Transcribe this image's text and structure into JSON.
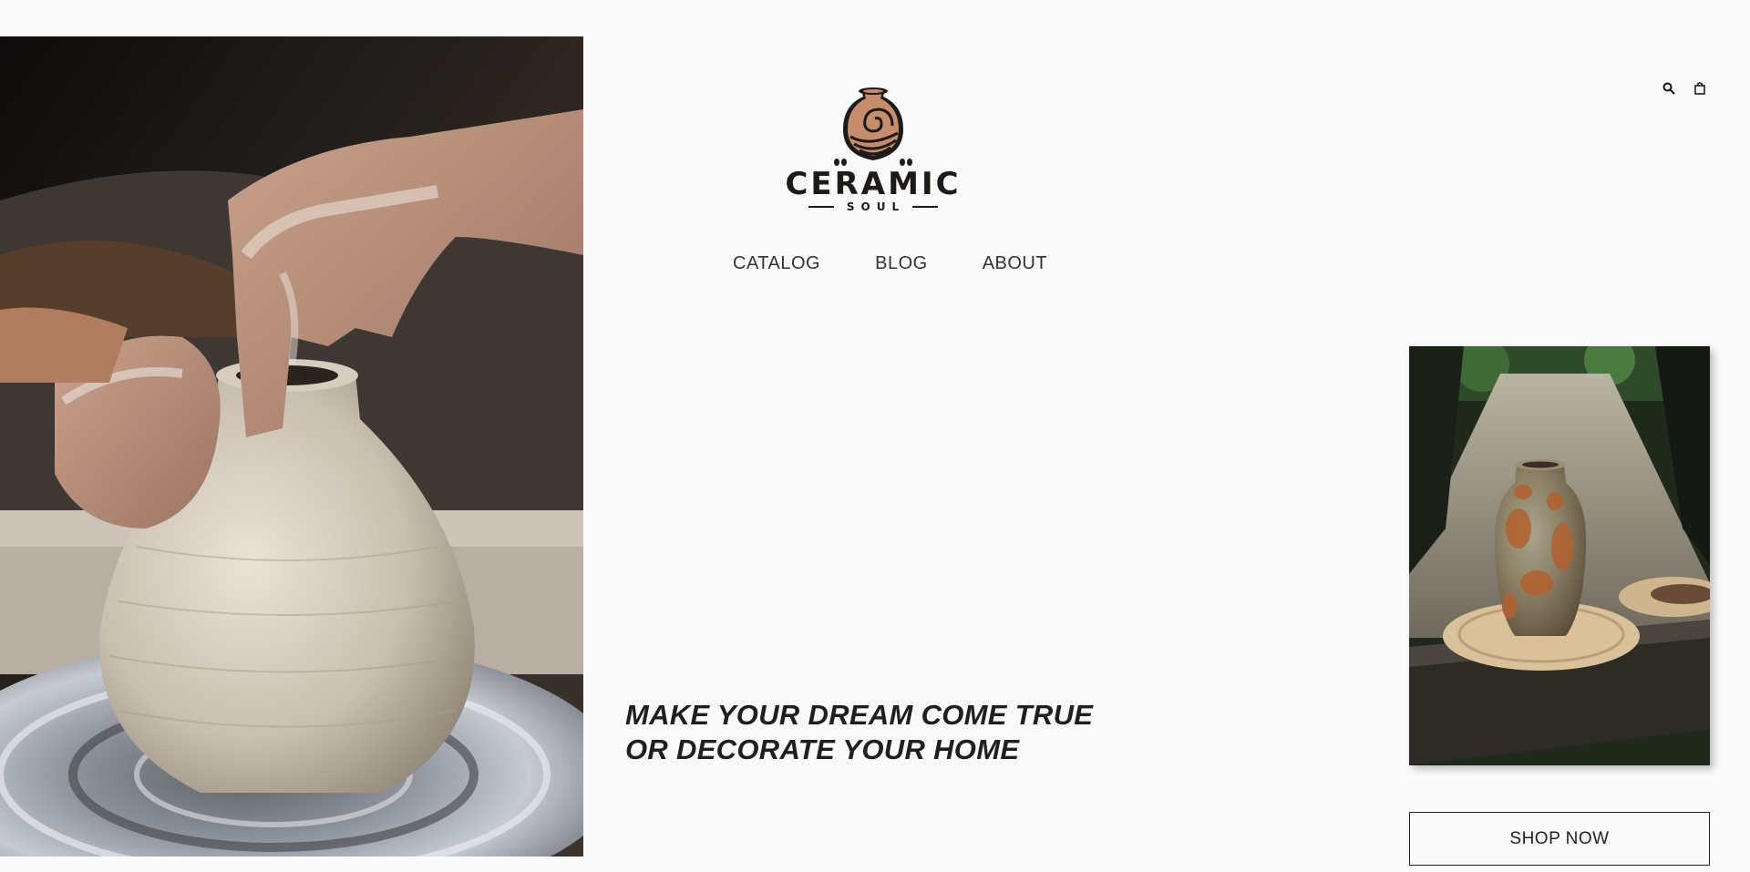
{
  "brand": {
    "name": "CERAMIC",
    "subname": "SOUL",
    "colors": {
      "accent": "#c58d6b",
      "ink": "#1e1a17",
      "background": "#fafafa"
    }
  },
  "nav": {
    "items": [
      {
        "label": "CATALOG"
      },
      {
        "label": "BLOG"
      },
      {
        "label": "ABOUT"
      }
    ]
  },
  "header_icons": {
    "search": "search-icon",
    "cart": "shopping-bag-icon"
  },
  "hero": {
    "tagline_line1": "MAKE YOUR DREAM COME TRUE",
    "tagline_line2": "OR DECORATE YOUR HOME"
  },
  "product": {
    "cta_label": "SHOP NOW"
  }
}
